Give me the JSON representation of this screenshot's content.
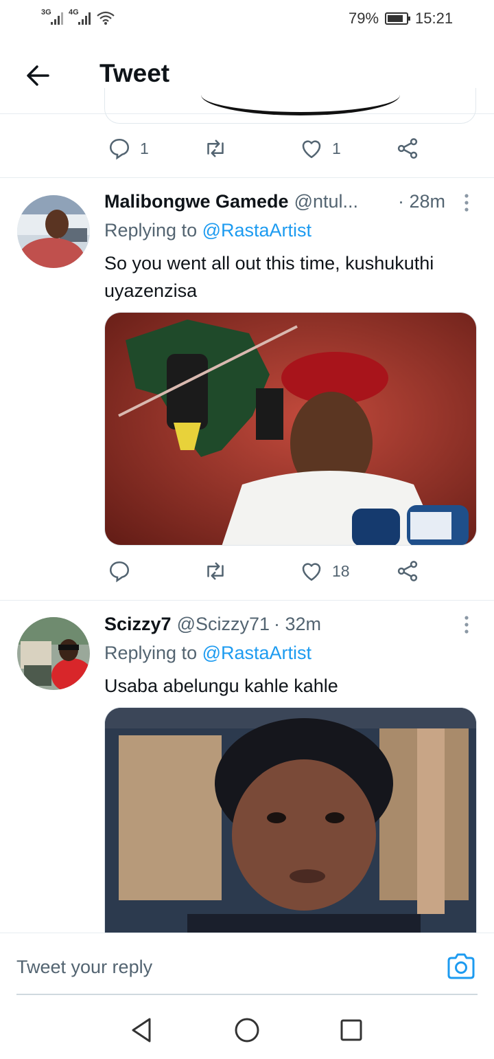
{
  "status_bar": {
    "sim1_label": "3G",
    "sim2_label": "4G",
    "battery_percent": "79%",
    "time": "15:21"
  },
  "header": {
    "title": "Tweet"
  },
  "previous_tweet": {
    "reply_count": "1",
    "like_count": "1"
  },
  "tweets": [
    {
      "display_name": "Malibongwe Gamede",
      "handle": "@ntul...",
      "time": "· 28m",
      "replying_prefix": "Replying to",
      "replying_to": "@RastaArtist",
      "text": "So you went all out this time, kushukuthi uyazenzisa",
      "reply_count": "",
      "like_count": "18"
    },
    {
      "display_name": "Scizzy7",
      "handle": "@Scizzy71",
      "time": "· 32m",
      "replying_prefix": "Replying to",
      "replying_to": "@RastaArtist",
      "text": "Usaba abelungu kahle kahle"
    }
  ],
  "composer": {
    "placeholder": "Tweet your reply"
  },
  "colors": {
    "accent": "#1d9bf0",
    "secondary_text": "#536471",
    "divider": "#e6ecf0"
  }
}
